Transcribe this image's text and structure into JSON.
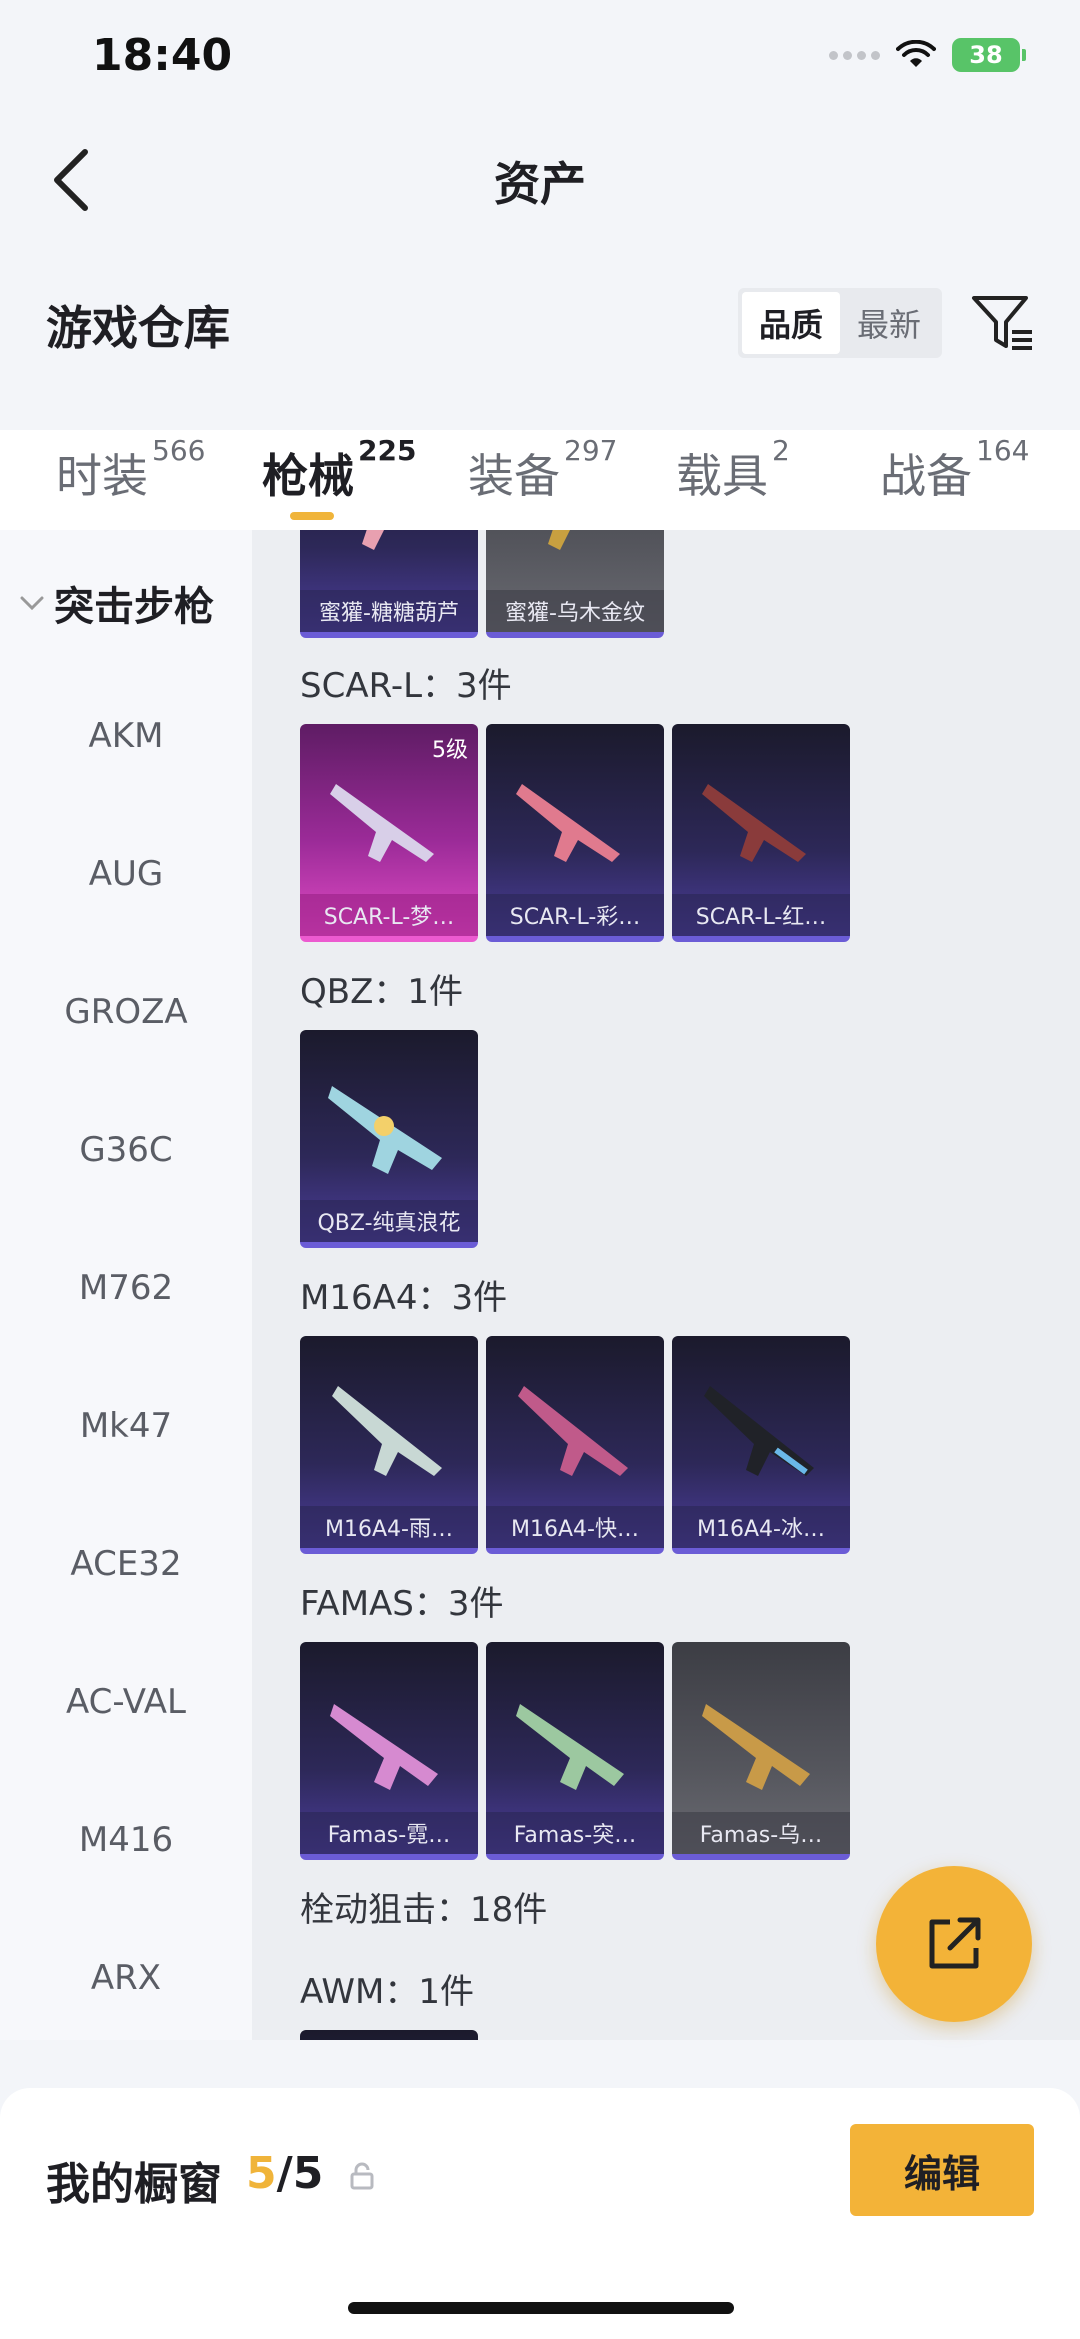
{
  "status": {
    "time": "18:40",
    "battery": "38"
  },
  "header": {
    "title": "资产"
  },
  "section": {
    "title": "游戏仓库",
    "sort_quality": "品质",
    "sort_latest": "最新"
  },
  "tabs": [
    {
      "label": "时装",
      "count": "566"
    },
    {
      "label": "枪械",
      "count": "225"
    },
    {
      "label": "装备",
      "count": "297"
    },
    {
      "label": "载具",
      "count": "2"
    },
    {
      "label": "战备",
      "count": "164"
    }
  ],
  "sidebar": {
    "category": "突击步枪",
    "items": [
      "AKM",
      "AUG",
      "GROZA",
      "G36C",
      "M762",
      "Mk47",
      "ACE32",
      "AC-VAL",
      "M416",
      "ARX"
    ]
  },
  "groups": {
    "top_cards": [
      "蜜獾-糖糖葫芦",
      "蜜獾-乌木金纹"
    ],
    "scar": {
      "title": "SCAR-L：3件",
      "cards": [
        "SCAR-L-梦…",
        "SCAR-L-彩…",
        "SCAR-L-红…"
      ],
      "badge": "5级"
    },
    "qbz": {
      "title": "QBZ：1件",
      "cards": [
        "QBZ-纯真浪花"
      ]
    },
    "m16": {
      "title": "M16A4：3件",
      "cards": [
        "M16A4-雨…",
        "M16A4-快…",
        "M16A4-冰…"
      ]
    },
    "famas": {
      "title": "FAMAS：3件",
      "cards": [
        "Famas-霓…",
        "Famas-突…",
        "Famas-乌…"
      ]
    },
    "bolt": {
      "title": "栓动狙击：18件"
    },
    "awm": {
      "title": "AWM：1件"
    }
  },
  "bottom": {
    "label": "我的橱窗",
    "current": "5",
    "total": "/5",
    "edit": "编辑"
  },
  "colors": {
    "accent": "#f3b338",
    "card_purple": "#4b3d9a",
    "card_pink": "#e04bc4"
  }
}
